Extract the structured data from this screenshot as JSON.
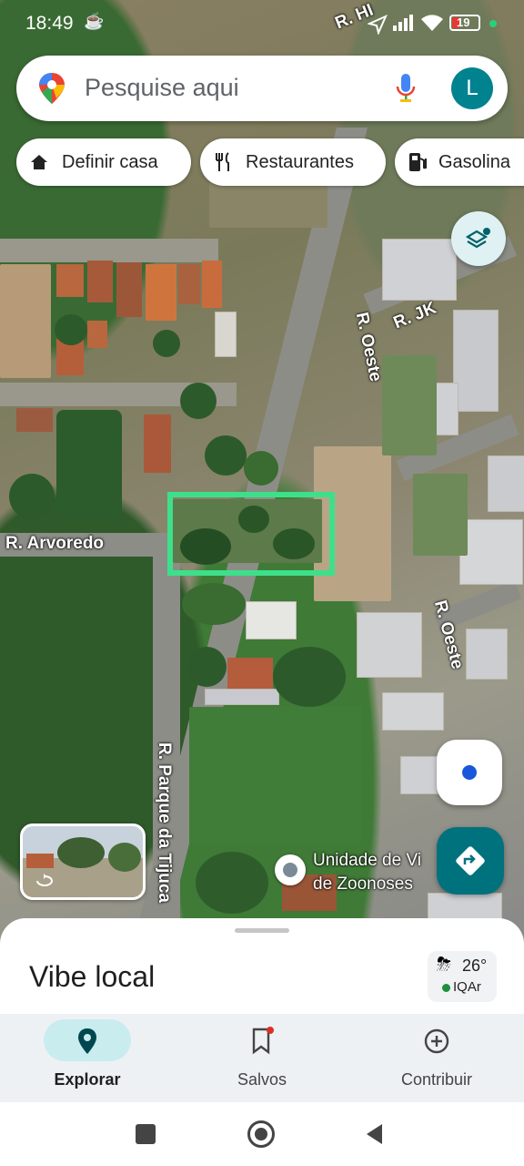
{
  "status_bar": {
    "time": "18:49",
    "battery": "19"
  },
  "search": {
    "placeholder": "Pesquise aqui",
    "avatar_letter": "L"
  },
  "chips": [
    {
      "label": "Definir casa",
      "icon": "home-icon"
    },
    {
      "label": "Restaurantes",
      "icon": "restaurant-icon"
    },
    {
      "label": "Gasolina",
      "icon": "gas-station-icon"
    }
  ],
  "map_labels": {
    "street_hi": "R. HI",
    "street_jk": "R. JK",
    "street_oeste_1": "R. Oeste",
    "street_oeste_2": "R. Oeste",
    "street_arvoredo": "R. Arvoredo",
    "street_parque": "R. Parque da Tijuca",
    "poi_line1": "Unidade de Vi",
    "poi_line2": "de Zoonoses"
  },
  "highlight_color": "#3de08a",
  "bottom_sheet": {
    "title": "Vibe local",
    "weather_temp": "26°",
    "air_quality": "IQAr"
  },
  "bottom_nav": [
    {
      "label": "Explorar",
      "icon": "explore-pin-icon",
      "active": true
    },
    {
      "label": "Salvos",
      "icon": "bookmark-icon",
      "active": false
    },
    {
      "label": "Contribuir",
      "icon": "add-circle-icon",
      "active": false
    }
  ]
}
